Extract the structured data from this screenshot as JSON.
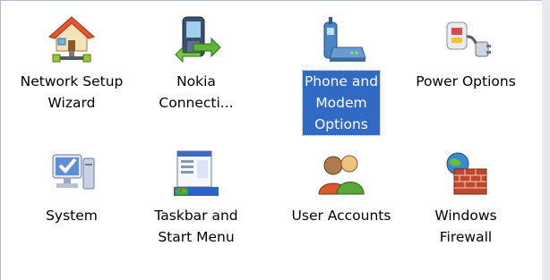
{
  "items": [
    {
      "label": "Network Setup\nWizard",
      "icon": "network-setup-house-icon",
      "selected": false
    },
    {
      "label": "Nokia\nConnecti...",
      "icon": "nokia-phone-sync-icon",
      "selected": false
    },
    {
      "label": "Phone and\nModem\nOptions",
      "icon": "phone-modem-icon",
      "selected": true
    },
    {
      "label": "Power Options",
      "icon": "power-plug-icon",
      "selected": false
    },
    {
      "label": "System",
      "icon": "computer-system-icon",
      "selected": false
    },
    {
      "label": "Taskbar and\nStart Menu",
      "icon": "taskbar-start-menu-icon",
      "selected": false
    },
    {
      "label": "User Accounts",
      "icon": "user-accounts-icon",
      "selected": false
    },
    {
      "label": "Windows\nFirewall",
      "icon": "windows-firewall-icon",
      "selected": false
    }
  ],
  "colors": {
    "selection": "#316ac5",
    "selection_text": "#ffffff",
    "background": "#ffffff"
  }
}
